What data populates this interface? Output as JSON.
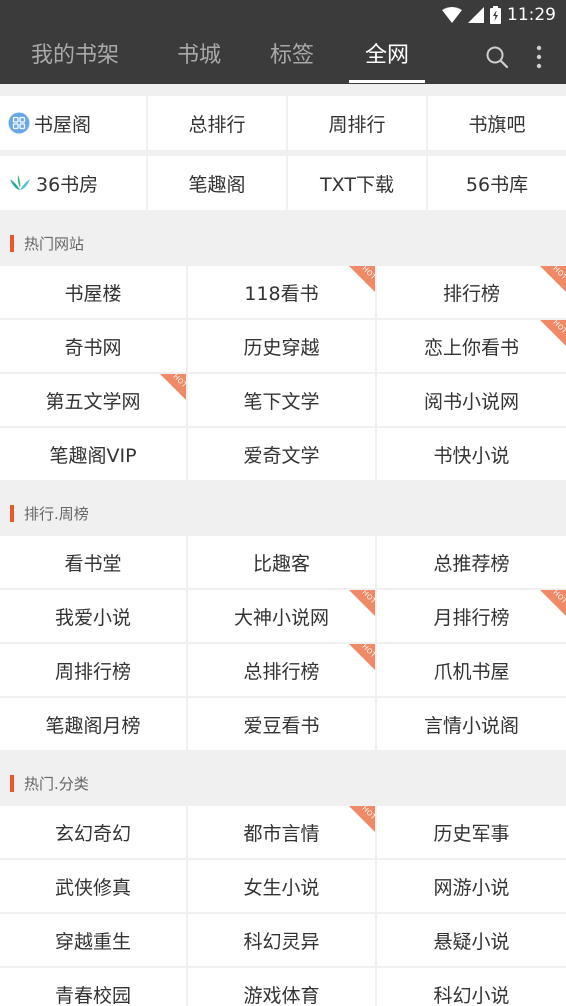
{
  "status_bar": {
    "time": "11:29",
    "icons": [
      "wifi-icon",
      "signal-icon",
      "battery-icon"
    ]
  },
  "app_bar": {
    "tabs": [
      {
        "label": "我的书架",
        "active": false
      },
      {
        "label": "书城",
        "active": false
      },
      {
        "label": "标签",
        "active": false
      },
      {
        "label": "全网",
        "active": true
      }
    ],
    "actions": [
      "search-icon",
      "more-vert-icon"
    ]
  },
  "quick_links": [
    [
      {
        "label": "书屋阁",
        "icon": "grid-badge-icon"
      },
      {
        "label": "总排行"
      },
      {
        "label": "周排行"
      },
      {
        "label": "书旗吧"
      }
    ],
    [
      {
        "label": "36书房",
        "icon": "book-leaf-icon"
      },
      {
        "label": "笔趣阁"
      },
      {
        "label": "TXT下载"
      },
      {
        "label": "56书库"
      }
    ]
  ],
  "hot_badge_text": "HOT",
  "colors": {
    "accent": "#e8582c",
    "hot_badge": "#f08a66",
    "app_bar": "#3b3b3b"
  },
  "sections": [
    {
      "title": "热门网站",
      "items": [
        {
          "label": "书屋楼",
          "hot": false
        },
        {
          "label": "118看书",
          "hot": true
        },
        {
          "label": "排行榜",
          "hot": true
        },
        {
          "label": "奇书网",
          "hot": false
        },
        {
          "label": "历史穿越",
          "hot": false
        },
        {
          "label": "恋上你看书",
          "hot": true
        },
        {
          "label": "第五文学网",
          "hot": true
        },
        {
          "label": "笔下文学",
          "hot": false
        },
        {
          "label": "阅书小说网",
          "hot": false
        },
        {
          "label": "笔趣阁VIP",
          "hot": false
        },
        {
          "label": "爱奇文学",
          "hot": false
        },
        {
          "label": "书快小说",
          "hot": false
        }
      ]
    },
    {
      "title": "排行.周榜",
      "items": [
        {
          "label": "看书堂",
          "hot": false
        },
        {
          "label": "比趣客",
          "hot": false
        },
        {
          "label": "总推荐榜",
          "hot": false
        },
        {
          "label": "我爱小说",
          "hot": false
        },
        {
          "label": "大神小说网",
          "hot": true
        },
        {
          "label": "月排行榜",
          "hot": true
        },
        {
          "label": "周排行榜",
          "hot": false
        },
        {
          "label": "总排行榜",
          "hot": true
        },
        {
          "label": "爪机书屋",
          "hot": false
        },
        {
          "label": "笔趣阁月榜",
          "hot": false
        },
        {
          "label": "爱豆看书",
          "hot": false
        },
        {
          "label": "言情小说阁",
          "hot": false
        }
      ]
    },
    {
      "title": "热门.分类",
      "items": [
        {
          "label": "玄幻奇幻",
          "hot": false
        },
        {
          "label": "都市言情",
          "hot": true
        },
        {
          "label": "历史军事",
          "hot": false
        },
        {
          "label": "武侠修真",
          "hot": false
        },
        {
          "label": "女生小说",
          "hot": false
        },
        {
          "label": "网游小说",
          "hot": false
        },
        {
          "label": "穿越重生",
          "hot": false
        },
        {
          "label": "科幻灵异",
          "hot": false
        },
        {
          "label": "悬疑小说",
          "hot": false
        },
        {
          "label": "青春校园",
          "hot": false
        },
        {
          "label": "游戏体育",
          "hot": false
        },
        {
          "label": "科幻小说",
          "hot": false
        }
      ]
    }
  ]
}
